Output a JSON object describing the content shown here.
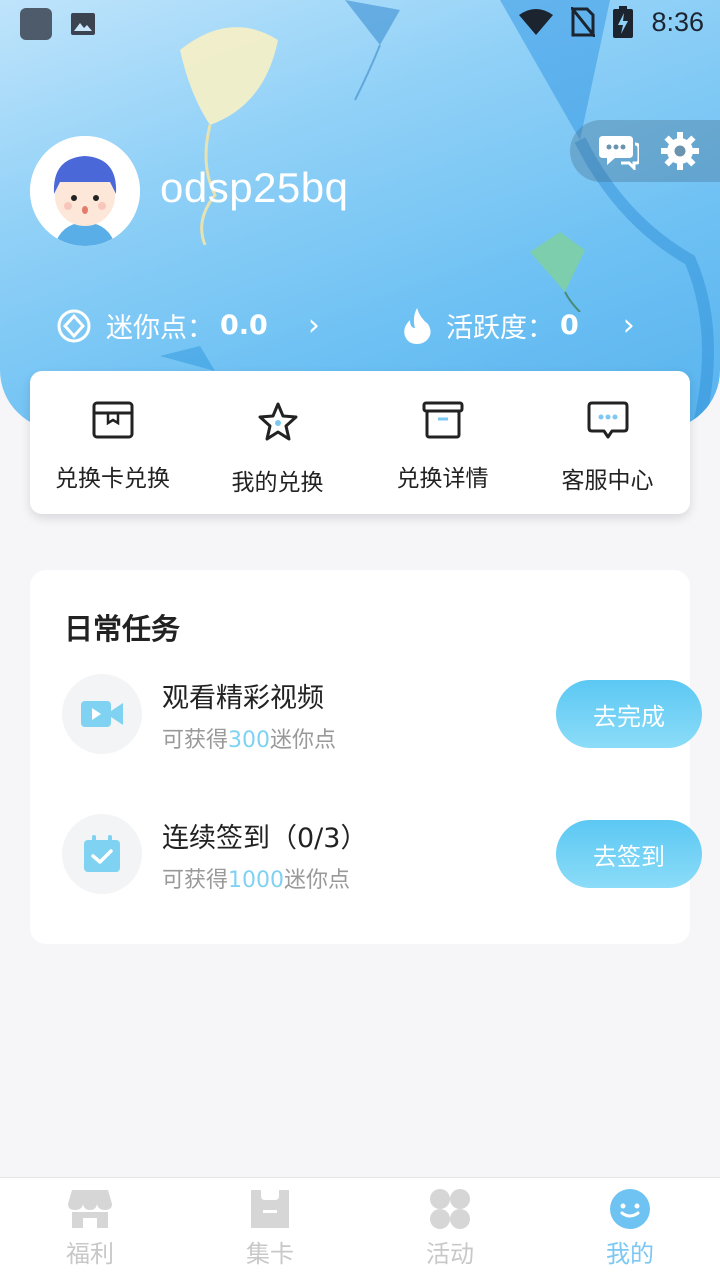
{
  "status_bar": {
    "time": "8:36"
  },
  "profile": {
    "username": "odsp25bq"
  },
  "stats": [
    {
      "label": "迷你点：",
      "value": "0.0"
    },
    {
      "label": "活跃度：",
      "value": "0"
    }
  ],
  "quick_menu": [
    {
      "label": "兑换卡兑换",
      "icon": "card-box-icon"
    },
    {
      "label": "我的兑换",
      "icon": "star-icon"
    },
    {
      "label": "兑换详情",
      "icon": "archive-box-icon"
    },
    {
      "label": "客服中心",
      "icon": "chat-bubble-icon"
    }
  ],
  "tasks": {
    "title": "日常任务",
    "items": [
      {
        "name": "观看精彩视频",
        "desc_prefix": "可获得",
        "desc_value": "300",
        "desc_suffix": "迷你点",
        "button": "去完成"
      },
      {
        "name": "连续签到（0/3）",
        "desc_prefix": "可获得",
        "desc_value": "1000",
        "desc_suffix": "迷你点",
        "button": "去签到"
      }
    ]
  },
  "bottom_nav": [
    {
      "label": "福利",
      "active": false
    },
    {
      "label": "集卡",
      "active": false
    },
    {
      "label": "活动",
      "active": false
    },
    {
      "label": "我的",
      "active": true
    }
  ],
  "colors": {
    "accent": "#7cc8f3",
    "header": "#6cc0f3",
    "highlight": "#7fd2f2"
  }
}
